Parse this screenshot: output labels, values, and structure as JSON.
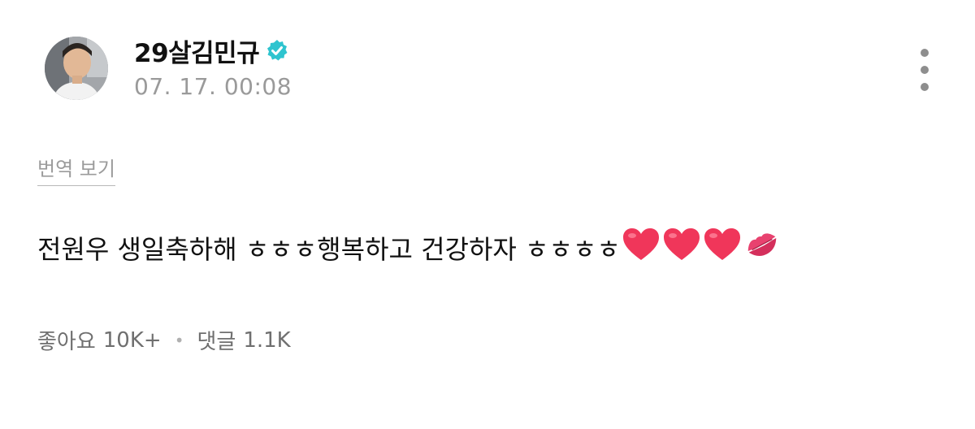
{
  "post": {
    "author_name": "29살김민규",
    "timestamp": "07. 17. 00:08",
    "translate_label": "번역 보기",
    "text": "전원우 생일축하해 ㅎㅎㅎ행복하고 건강하자 ㅎㅎㅎㅎ",
    "emojis": [
      "heart-icon",
      "heart-icon",
      "heart-icon",
      "kiss-mark-icon"
    ]
  },
  "stats": {
    "likes_label": "좋아요",
    "likes_count": "10K+",
    "separator": "•",
    "comments_label": "댓글",
    "comments_count": "1.1K"
  },
  "colors": {
    "verified": "#2ec4cf",
    "heart": "#f0365a",
    "kiss": "#e8426f",
    "muted_text": "#9a9a9a"
  }
}
